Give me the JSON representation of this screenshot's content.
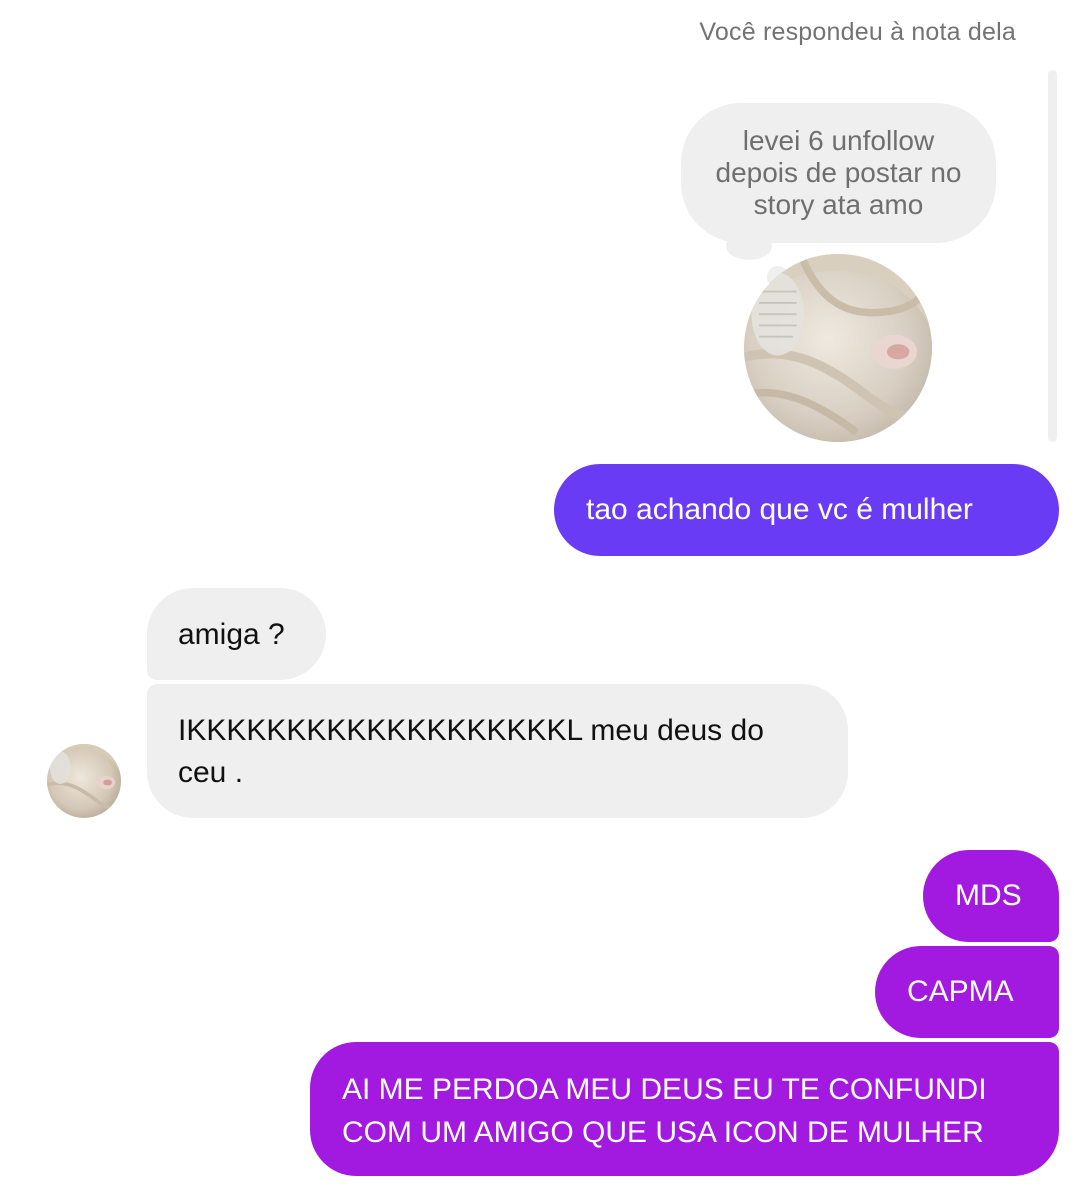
{
  "thread": {
    "context_label": "Você respondeu à nota dela",
    "note": {
      "text": "levei 6 unfollow depois de postar no story ata amo"
    },
    "messages": [
      {
        "id": "b1",
        "direction": "sent",
        "color": "#6a3bf5",
        "text": "tao achando que vc é mulher"
      },
      {
        "id": "b2",
        "direction": "received",
        "color": "#efefef",
        "text": "amiga ?"
      },
      {
        "id": "b3",
        "direction": "received",
        "color": "#efefef",
        "text": "IKKKKKKKKKKKKKKKKKKKL meu deus do ceu ."
      },
      {
        "id": "b4",
        "direction": "sent",
        "color": "#a21adf",
        "text": "MDS"
      },
      {
        "id": "b5",
        "direction": "sent",
        "color": "#a21adf",
        "text": "CAPMA"
      },
      {
        "id": "b6",
        "direction": "sent",
        "color": "#a21adf",
        "text": "AI ME PERDOA MEU DEUS EU TE CONFUNDI COM UM AMIGO QUE USA ICON DE MULHER"
      }
    ],
    "avatar_icon": "profile-picture-avatar"
  },
  "colors": {
    "sent_blue": "#6a3bf5",
    "sent_purple": "#a21adf",
    "received_bg": "#efefef",
    "meta_text": "#737373"
  }
}
